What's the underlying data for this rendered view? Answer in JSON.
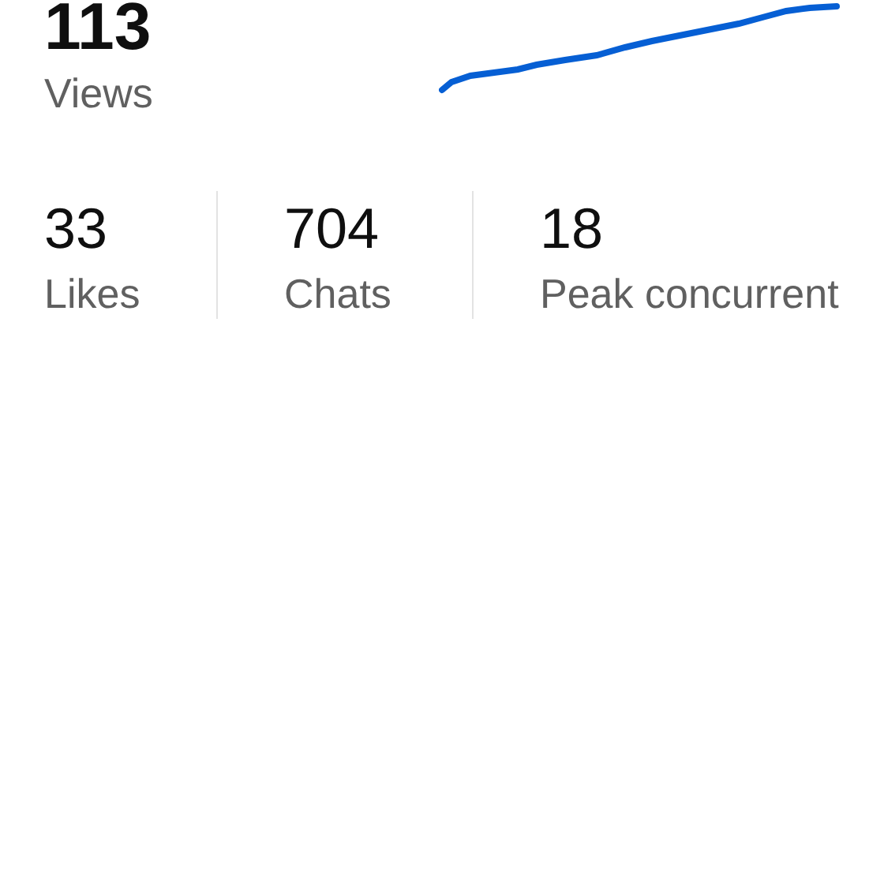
{
  "views": {
    "value": "113",
    "label": "Views"
  },
  "stats": [
    {
      "value": "33",
      "label": "Likes"
    },
    {
      "value": "704",
      "label": "Chats"
    },
    {
      "value": "18",
      "label": "Peak concurrent"
    }
  ]
}
